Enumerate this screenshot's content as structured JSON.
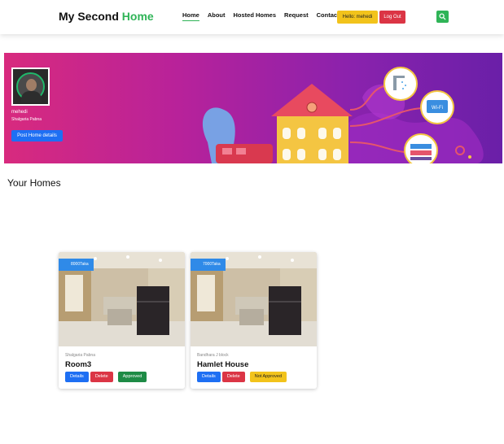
{
  "navbar": {
    "brand_main": "My Second",
    "brand_accent": "Home",
    "links": [
      "Home",
      "About",
      "Hosted Homes",
      "Request",
      "Contact"
    ],
    "hello_label": "Hello: mehedi",
    "logout_label": "Log Out",
    "accent_color": "#2fb457"
  },
  "profile": {
    "name": "mehedi",
    "location": "Shalgaria Pabna",
    "post_button": "Post Home details"
  },
  "section": {
    "title": "Your Homes"
  },
  "homes": [
    {
      "price": "8000Taka",
      "location": "Shalgaria Pabna",
      "title": "Room3",
      "details_label": "Details",
      "delete_label": "Delete",
      "status": "Approved",
      "status_color": "#1e8b46"
    },
    {
      "price": "7000Taka",
      "location": "Bandhara J block",
      "title": "Hamlet House",
      "details_label": "Details",
      "delete_label": "Delete",
      "status": "Not Approved",
      "status_color": "#f2c31b"
    }
  ]
}
